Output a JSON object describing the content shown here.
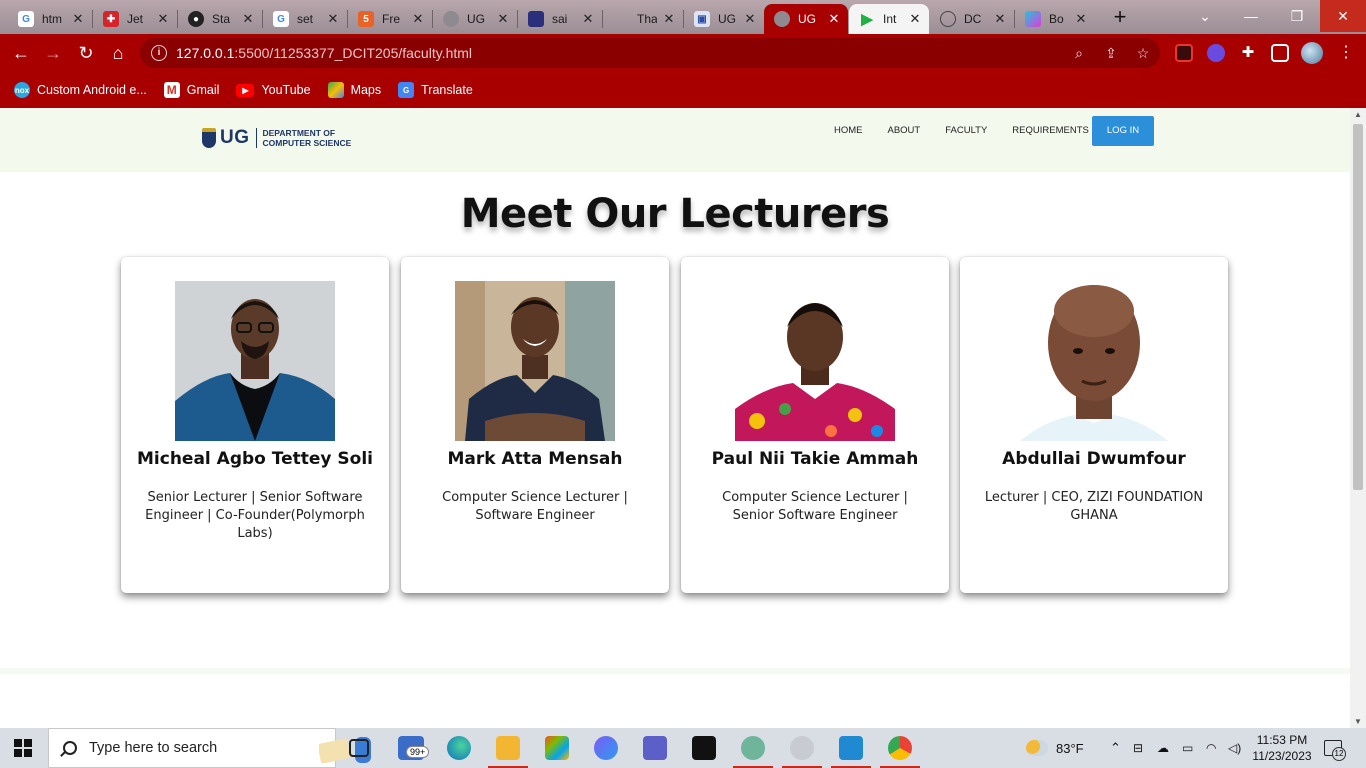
{
  "browser": {
    "tabs": [
      {
        "label": "htm",
        "favicon": "google-icon"
      },
      {
        "label": "Jet",
        "favicon": "jet-icon"
      },
      {
        "label": "Sta",
        "favicon": "github-icon"
      },
      {
        "label": "set",
        "favicon": "google-icon"
      },
      {
        "label": "Fre",
        "favicon": "html5-icon"
      },
      {
        "label": "UG",
        "favicon": "globe-icon"
      },
      {
        "label": "sai",
        "favicon": "ug-crest-icon"
      },
      {
        "label": "Tha",
        "favicon": "blank-icon"
      },
      {
        "label": "UG",
        "favicon": "ug-site-icon"
      },
      {
        "label": "UG",
        "favicon": "globe-icon"
      },
      {
        "label": "Int",
        "favicon": "play-icon"
      },
      {
        "label": "DC",
        "favicon": "github-icon"
      },
      {
        "label": "Bo",
        "favicon": "bootstrap-icon"
      }
    ],
    "active_tab_index": 9,
    "url_host": "127.0.0.1",
    "url_rest": ":5500/11253377_DCIT205/faculty.html",
    "bookmarks": [
      {
        "label": "Custom Android e...",
        "icon": "nox-icon"
      },
      {
        "label": "Gmail",
        "icon": "gmail-icon"
      },
      {
        "label": "YouTube",
        "icon": "youtube-icon"
      },
      {
        "label": "Maps",
        "icon": "maps-icon"
      },
      {
        "label": "Translate",
        "icon": "translate-icon"
      }
    ]
  },
  "site": {
    "logo": {
      "abbr": "UG",
      "line1": "DEPARTMENT OF",
      "line2": "COMPUTER SCIENCE"
    },
    "nav": [
      "HOME",
      "ABOUT",
      "FACULTY",
      "REQUIREMENTS"
    ],
    "login_label": "LOG IN",
    "heading": "Meet Our Lecturers",
    "lecturers": [
      {
        "name": "Micheal Agbo Tettey Soli",
        "role": "Senior Lecturer | Senior Software Engineer | Co-Founder(Polymorph Labs)"
      },
      {
        "name": "Mark Atta Mensah",
        "role": "Computer Science Lecturer | Software Engineer"
      },
      {
        "name": "Paul Nii Takie Ammah",
        "role": "Computer Science Lecturer | Senior Software Engineer"
      },
      {
        "name": "Abdullai Dwumfour",
        "role": "Lecturer | CEO, ZIZI FOUNDATION GHANA"
      }
    ]
  },
  "taskbar": {
    "search_placeholder": "Type here to search",
    "mail_badge": "99+",
    "weather": "83°F",
    "time": "11:53 PM",
    "date": "11/23/2023",
    "notification_count": "12"
  },
  "colors": {
    "browser_accent": "#a80000",
    "login_button": "#2c8fd9",
    "nav_background": "#f4f9ee"
  }
}
